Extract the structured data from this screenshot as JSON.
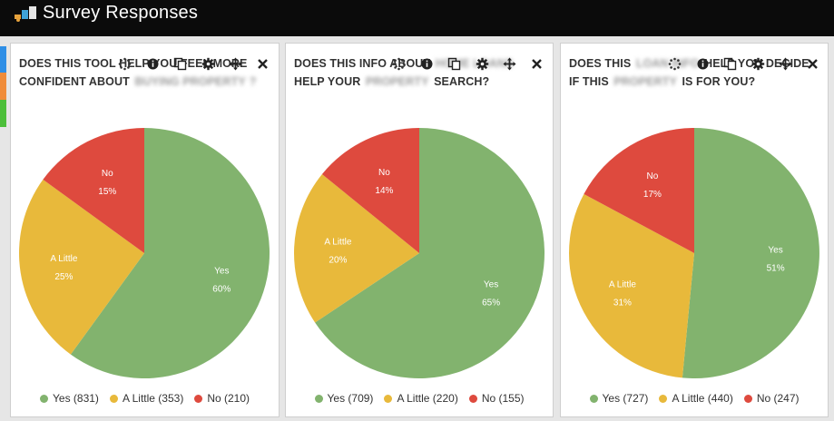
{
  "app": {
    "title": "Survey Responses"
  },
  "colors": {
    "yes": "#82b36e",
    "a_little": "#e8b93b",
    "no": "#de4a3e"
  },
  "widgets": [
    {
      "title_parts": [
        "DOES THIS TOOL HELP YOU FEEL MORE CONFIDENT ABOUT ",
        "BUYING PROPERTY",
        "?"
      ],
      "title_blur": [
        false,
        true,
        true
      ],
      "slices": [
        {
          "key": "yes",
          "label": "Yes",
          "pct": "60%",
          "value": 60
        },
        {
          "key": "a_little",
          "label": "A Little",
          "pct": "25%",
          "value": 25
        },
        {
          "key": "no",
          "label": "No",
          "pct": "15%",
          "value": 15
        }
      ],
      "legend": [
        "Yes (831)",
        "A Little (353)",
        "No (210)"
      ]
    },
    {
      "title_parts": [
        "DOES THIS INFO ABOUT ",
        "HOME LOANS",
        " HELP YOUR ",
        "PROPERTY",
        " SEARCH?"
      ],
      "title_blur": [
        false,
        true,
        false,
        true,
        false
      ],
      "slices": [
        {
          "key": "yes",
          "label": "Yes",
          "pct": "65%",
          "value": 65
        },
        {
          "key": "a_little",
          "label": "A Little",
          "pct": "20%",
          "value": 20
        },
        {
          "key": "no",
          "label": "No",
          "pct": "14%",
          "value": 14
        }
      ],
      "legend": [
        "Yes (709)",
        "A Little (220)",
        "No (155)"
      ]
    },
    {
      "title_parts": [
        "DOES THIS ",
        "LOAN INFO",
        " HELP YOU DECIDE IF THIS ",
        "PROPERTY",
        " IS FOR YOU?"
      ],
      "title_blur": [
        false,
        true,
        false,
        true,
        false
      ],
      "slices": [
        {
          "key": "yes",
          "label": "Yes",
          "pct": "51%",
          "value": 51
        },
        {
          "key": "a_little",
          "label": "A Little",
          "pct": "31%",
          "value": 31
        },
        {
          "key": "no",
          "label": "No",
          "pct": "17%",
          "value": 17
        }
      ],
      "legend": [
        "Yes (727)",
        "A Little (440)",
        "No (247)"
      ]
    }
  ],
  "icons": {
    "refresh": "refresh-icon",
    "info": "info-icon",
    "copy": "copy-icon",
    "settings": "gear-icon",
    "move": "move-icon",
    "close": "close-icon"
  }
}
